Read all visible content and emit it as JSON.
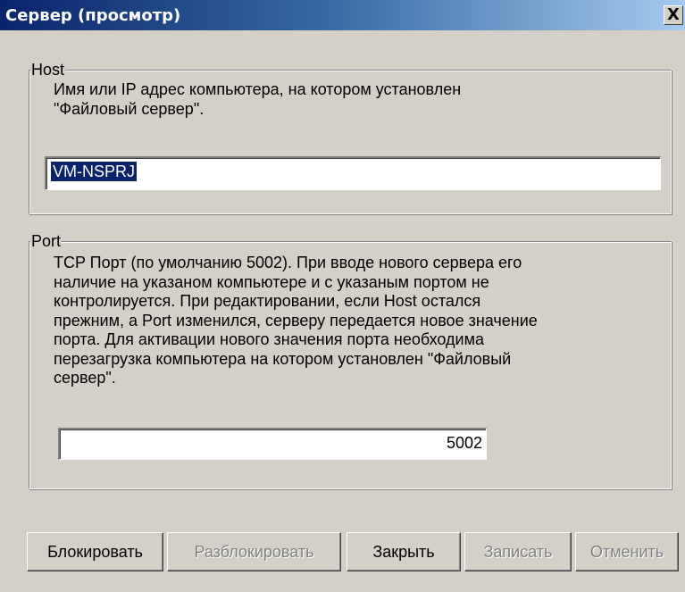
{
  "window": {
    "title": "Сервер (просмотр)",
    "close_label": "X"
  },
  "host": {
    "legend": "Host",
    "description": "Имя или IP адрес компьютера, на котором установлен\n\"Файловый сервер\".",
    "value": "VM-NSPRJ"
  },
  "port": {
    "legend": "Port",
    "description": "TCP Порт (по умолчанию 5002). При вводе нового сервера его\nналичие на указаном компьютере и с указаным портом не\nконтролируется. При редактировании, если Host остался\nпрежним, а Port изменился, серверу передается новое значение\nпорта. Для активации нового значения порта необходима\nперезагрузка компьютера на котором установлен \"Файловый\nсервер\".",
    "value": "5002"
  },
  "buttons": {
    "block": "Блокировать",
    "unblock": "Разблокировать",
    "close": "Закрыть",
    "save": "Записать",
    "cancel": "Отменить"
  },
  "state": {
    "unblock_enabled": false,
    "save_enabled": false,
    "cancel_enabled": false
  }
}
